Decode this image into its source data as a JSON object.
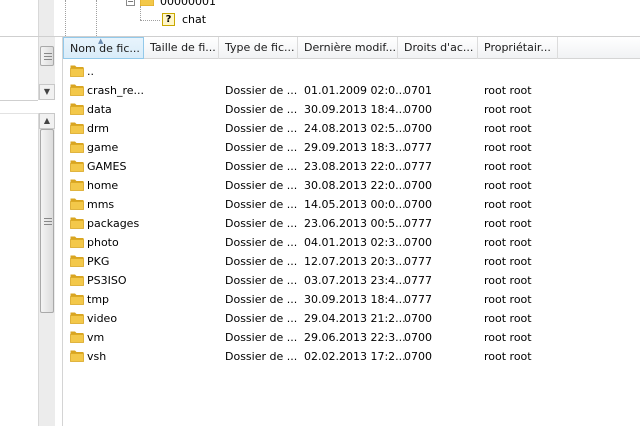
{
  "tree": {
    "parent_node": {
      "label": "00000001"
    },
    "child_node": {
      "label": "chat"
    }
  },
  "columns": [
    {
      "label": "Nom de fic..."
    },
    {
      "label": "Taille de fi..."
    },
    {
      "label": "Type de fic..."
    },
    {
      "label": "Dernière modif..."
    },
    {
      "label": "Droits d'ac..."
    },
    {
      "label": "Propriétair..."
    }
  ],
  "files": [
    {
      "name": "..",
      "size": "",
      "type": "",
      "modified": "",
      "perms": "",
      "owner": ""
    },
    {
      "name": "crash_re...",
      "size": "",
      "type": "Dossier de ...",
      "modified": "01.01.2009 02:0...",
      "perms": "0701",
      "owner": "root root"
    },
    {
      "name": "data",
      "size": "",
      "type": "Dossier de ...",
      "modified": "30.09.2013 18:4...",
      "perms": "0700",
      "owner": "root root"
    },
    {
      "name": "drm",
      "size": "",
      "type": "Dossier de ...",
      "modified": "24.08.2013 02:5...",
      "perms": "0700",
      "owner": "root root"
    },
    {
      "name": "game",
      "size": "",
      "type": "Dossier de ...",
      "modified": "29.09.2013 18:3...",
      "perms": "0777",
      "owner": "root root"
    },
    {
      "name": "GAMES",
      "size": "",
      "type": "Dossier de ...",
      "modified": "23.08.2013 22:0...",
      "perms": "0777",
      "owner": "root root"
    },
    {
      "name": "home",
      "size": "",
      "type": "Dossier de ...",
      "modified": "30.08.2013 22:0...",
      "perms": "0700",
      "owner": "root root"
    },
    {
      "name": "mms",
      "size": "",
      "type": "Dossier de ...",
      "modified": "14.05.2013 00:0...",
      "perms": "0700",
      "owner": "root root"
    },
    {
      "name": "packages",
      "size": "",
      "type": "Dossier de ...",
      "modified": "23.06.2013 00:5...",
      "perms": "0777",
      "owner": "root root"
    },
    {
      "name": "photo",
      "size": "",
      "type": "Dossier de ...",
      "modified": "04.01.2013 02:3...",
      "perms": "0700",
      "owner": "root root"
    },
    {
      "name": "PKG",
      "size": "",
      "type": "Dossier de ...",
      "modified": "12.07.2013 20:3...",
      "perms": "0777",
      "owner": "root root"
    },
    {
      "name": "PS3ISO",
      "size": "",
      "type": "Dossier de ...",
      "modified": "03.07.2013 23:4...",
      "perms": "0777",
      "owner": "root root"
    },
    {
      "name": "tmp",
      "size": "",
      "type": "Dossier de ...",
      "modified": "30.09.2013 18:4...",
      "perms": "0777",
      "owner": "root root"
    },
    {
      "name": "video",
      "size": "",
      "type": "Dossier de ...",
      "modified": "29.04.2013 21:2...",
      "perms": "0700",
      "owner": "root root"
    },
    {
      "name": "vm",
      "size": "",
      "type": "Dossier de ...",
      "modified": "29.06.2013 22:3...",
      "perms": "0700",
      "owner": "root root"
    },
    {
      "name": "vsh",
      "size": "",
      "type": "Dossier de ...",
      "modified": "02.02.2013 17:2...",
      "perms": "0700",
      "owner": "root root"
    }
  ],
  "icons": {
    "folder": "folder-icon",
    "unknown_file": "question-mark-file-icon",
    "expander": "minus-expander-icon"
  },
  "colors": {
    "folder_fill": "#f3c84a",
    "folder_dark": "#d9a521",
    "header_sorted": "#d9ecf9"
  }
}
